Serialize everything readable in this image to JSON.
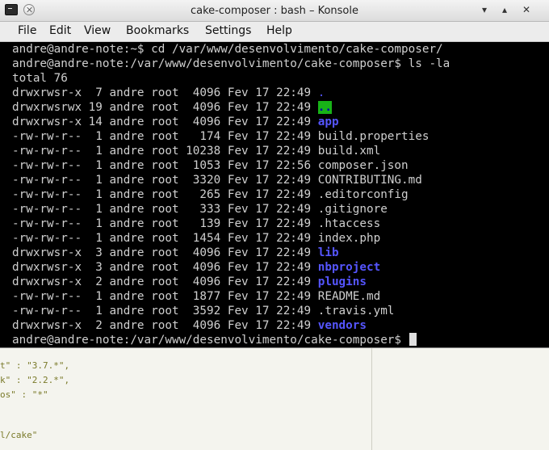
{
  "window": {
    "title": "cake-composer : bash – Konsole"
  },
  "menubar": {
    "items": [
      "File",
      "Edit",
      "View",
      "Bookmarks",
      "Settings",
      "Help"
    ]
  },
  "terminal": {
    "lines": [
      "andre@andre-note:~$ cd /var/www/desenvolvimento/cake-composer/",
      "andre@andre-note:/var/www/desenvolvimento/cake-composer$ ls -la",
      "total 76"
    ],
    "entries": [
      {
        "perms": "drwxrwsr-x",
        "links": "7",
        "owner": "andre",
        "group": "root",
        "size": "4096",
        "date": "Fev 17 22:49",
        "name": ".",
        "type": "dirdot"
      },
      {
        "perms": "drwxrwsrwx",
        "links": "19",
        "owner": "andre",
        "group": "root",
        "size": "4096",
        "date": "Fev 17 22:49",
        "name": "..",
        "type": "dirgreen"
      },
      {
        "perms": "drwxrwsr-x",
        "links": "14",
        "owner": "andre",
        "group": "root",
        "size": "4096",
        "date": "Fev 17 22:49",
        "name": "app",
        "type": "dir"
      },
      {
        "perms": "-rw-rw-r--",
        "links": "1",
        "owner": "andre",
        "group": "root",
        "size": "174",
        "date": "Fev 17 22:49",
        "name": "build.properties",
        "type": "file"
      },
      {
        "perms": "-rw-rw-r--",
        "links": "1",
        "owner": "andre",
        "group": "root",
        "size": "10238",
        "date": "Fev 17 22:49",
        "name": "build.xml",
        "type": "file"
      },
      {
        "perms": "-rw-rw-r--",
        "links": "1",
        "owner": "andre",
        "group": "root",
        "size": "1053",
        "date": "Fev 17 22:56",
        "name": "composer.json",
        "type": "file"
      },
      {
        "perms": "-rw-rw-r--",
        "links": "1",
        "owner": "andre",
        "group": "root",
        "size": "3320",
        "date": "Fev 17 22:49",
        "name": "CONTRIBUTING.md",
        "type": "file"
      },
      {
        "perms": "-rw-rw-r--",
        "links": "1",
        "owner": "andre",
        "group": "root",
        "size": "265",
        "date": "Fev 17 22:49",
        "name": ".editorconfig",
        "type": "file"
      },
      {
        "perms": "-rw-rw-r--",
        "links": "1",
        "owner": "andre",
        "group": "root",
        "size": "333",
        "date": "Fev 17 22:49",
        "name": ".gitignore",
        "type": "file"
      },
      {
        "perms": "-rw-rw-r--",
        "links": "1",
        "owner": "andre",
        "group": "root",
        "size": "139",
        "date": "Fev 17 22:49",
        "name": ".htaccess",
        "type": "file"
      },
      {
        "perms": "-rw-rw-r--",
        "links": "1",
        "owner": "andre",
        "group": "root",
        "size": "1454",
        "date": "Fev 17 22:49",
        "name": "index.php",
        "type": "file"
      },
      {
        "perms": "drwxrwsr-x",
        "links": "3",
        "owner": "andre",
        "group": "root",
        "size": "4096",
        "date": "Fev 17 22:49",
        "name": "lib",
        "type": "dir"
      },
      {
        "perms": "drwxrwsr-x",
        "links": "3",
        "owner": "andre",
        "group": "root",
        "size": "4096",
        "date": "Fev 17 22:49",
        "name": "nbproject",
        "type": "dir"
      },
      {
        "perms": "drwxrwsr-x",
        "links": "2",
        "owner": "andre",
        "group": "root",
        "size": "4096",
        "date": "Fev 17 22:49",
        "name": "plugins",
        "type": "dir"
      },
      {
        "perms": "-rw-rw-r--",
        "links": "1",
        "owner": "andre",
        "group": "root",
        "size": "1877",
        "date": "Fev 17 22:49",
        "name": "README.md",
        "type": "file"
      },
      {
        "perms": "-rw-rw-r--",
        "links": "1",
        "owner": "andre",
        "group": "root",
        "size": "3592",
        "date": "Fev 17 22:49",
        "name": ".travis.yml",
        "type": "file"
      },
      {
        "perms": "drwxrwsr-x",
        "links": "2",
        "owner": "andre",
        "group": "root",
        "size": "4096",
        "date": "Fev 17 22:49",
        "name": "vendors",
        "type": "dir"
      }
    ],
    "prompt": "andre@andre-note:/var/www/desenvolvimento/cake-composer$ "
  },
  "background_editor": {
    "lines": [
      "t\" : \"3.7.*\",",
      "k\" : \"2.2.*\",",
      "os\" : \"*\"",
      "l/cake\""
    ]
  },
  "colors": {
    "directory": "#5555ff",
    "highlight_dir_bg": "#18b218",
    "terminal_bg": "#000000",
    "terminal_fg": "#cfcfcf"
  }
}
